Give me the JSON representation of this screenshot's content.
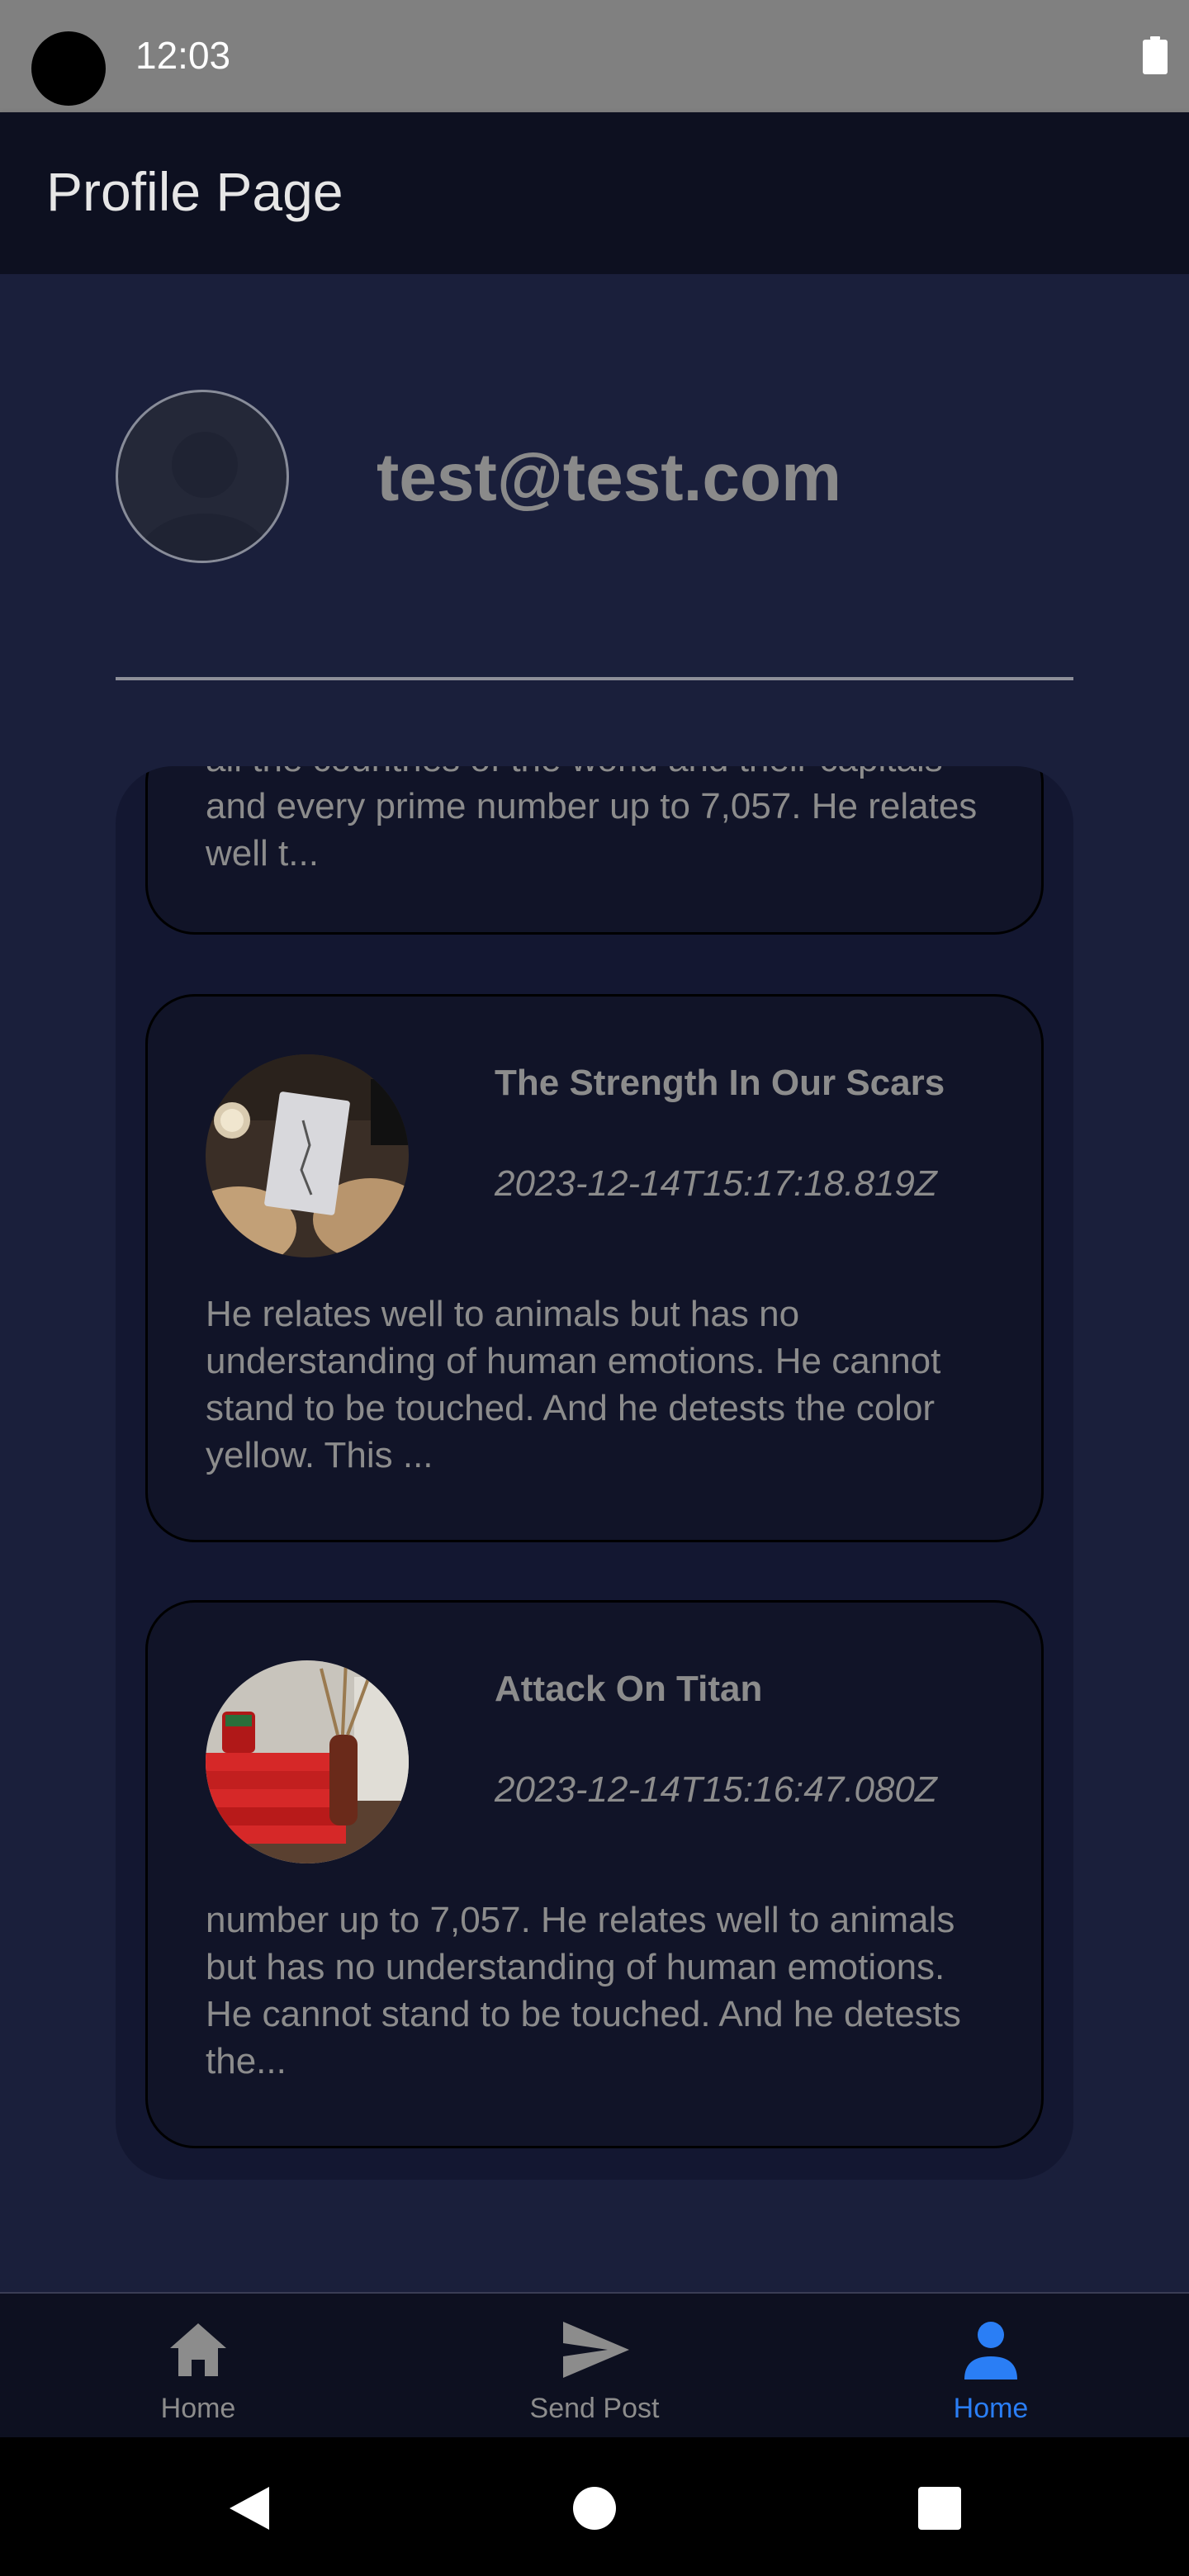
{
  "status": {
    "time": "12:03"
  },
  "app_bar": {
    "title": "Profile Page"
  },
  "profile": {
    "email": "test@test.com"
  },
  "posts": [
    {
      "partial_body": "all the countries of the world and their capitals and every prime number up to 7,057. He relates well t..."
    },
    {
      "title": "The Strength In Our Scars",
      "date": "2023-12-14T15:17:18.819Z",
      "body": "He relates well to animals but has no understanding of human emotions. He cannot stand to be touched. And he detests the color yellow. This ..."
    },
    {
      "title": "Attack On Titan",
      "date": "2023-12-14T15:16:47.080Z",
      "body": "number up to 7,057. He relates well to animals but has no understanding of human emotions. He cannot stand to be touched. And he detests the..."
    }
  ],
  "bottom_nav": {
    "items": [
      {
        "label": "Home",
        "icon": "home-icon",
        "active": false
      },
      {
        "label": "Send Post",
        "icon": "send-icon",
        "active": false
      },
      {
        "label": "Home",
        "icon": "person-icon",
        "active": true
      }
    ]
  },
  "colors": {
    "background": "#1a1f3b",
    "app_bar": "#0d1020",
    "card": "#111428",
    "accent": "#2a7ef5",
    "text_muted": "#8c8c8c"
  }
}
